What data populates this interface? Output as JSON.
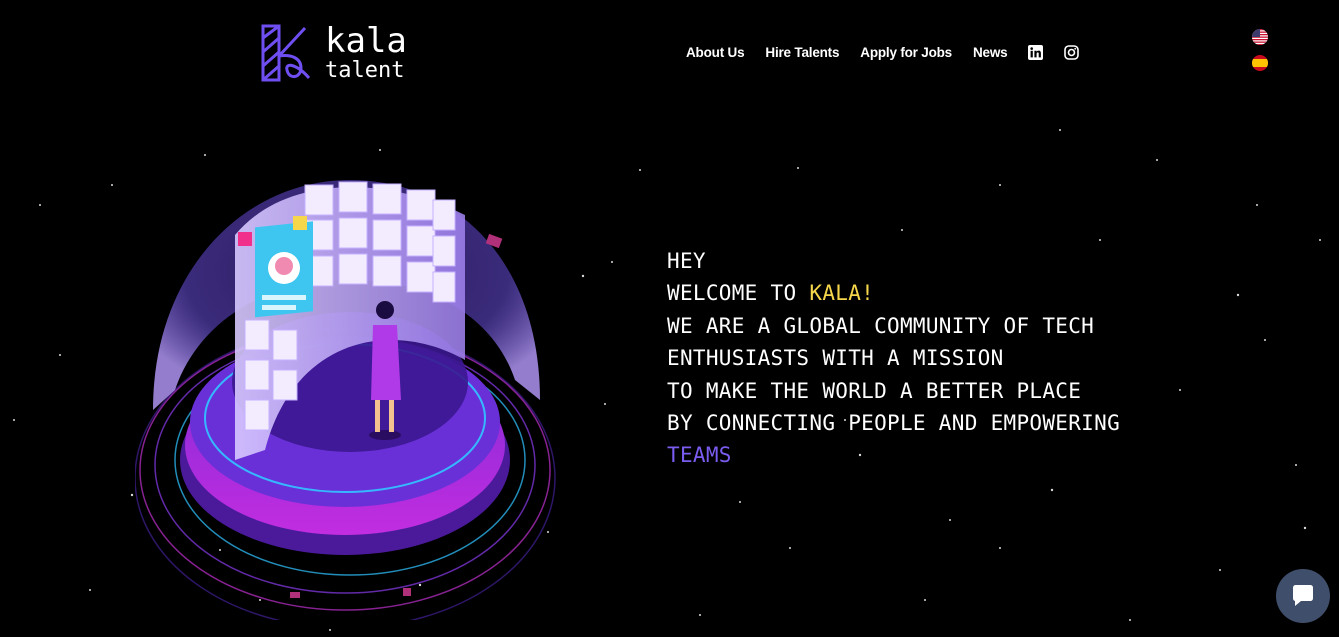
{
  "brand": {
    "name_line1": "kala",
    "name_line2": "talent",
    "mark_color": "#6f4ff2"
  },
  "nav": {
    "items": [
      {
        "label": "About Us"
      },
      {
        "label": "Hire Talents"
      },
      {
        "label": "Apply for Jobs"
      },
      {
        "label": "News"
      }
    ],
    "social": [
      {
        "icon": "linkedin-icon"
      },
      {
        "icon": "instagram-icon"
      }
    ]
  },
  "languages": [
    {
      "icon": "us-flag-icon"
    },
    {
      "icon": "spain-flag-icon"
    }
  ],
  "hero": {
    "line1": "HEY",
    "line2_prefix": "WELCOME TO ",
    "line2_highlight": "KALA!",
    "line3": "WE ARE A GLOBAL COMMUNITY OF TECH",
    "line4": "ENTHUSIASTS WITH A MISSION",
    "line5": "TO MAKE THE WORLD A BETTER PLACE",
    "line6": "BY CONNECTING PEOPLE AND EMPOWERING",
    "line7": "TEAMS",
    "colors": {
      "text": "#ffffff",
      "highlight_yellow": "#f6d64b",
      "highlight_purple": "#7b5cf0"
    }
  },
  "chat": {
    "icon": "chat-bubble-icon",
    "color": "#3f4f6b"
  },
  "background": {
    "color": "#000000"
  }
}
